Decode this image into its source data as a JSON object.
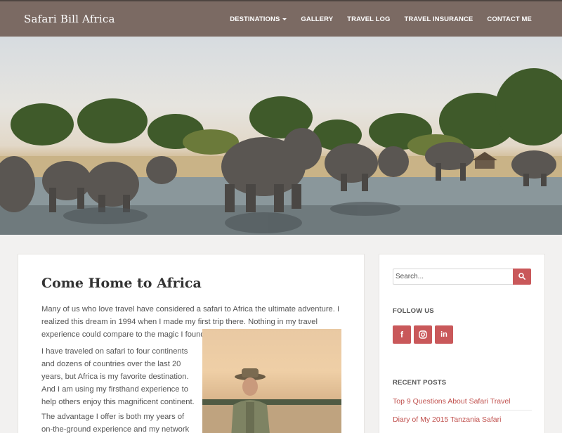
{
  "site": {
    "brand": "Safari Bill Africa"
  },
  "nav": {
    "items": [
      {
        "label": "Destinations"
      },
      {
        "label": "Gallery"
      },
      {
        "label": "Travel Log"
      },
      {
        "label": "Travel Insurance"
      },
      {
        "label": "Contact Me"
      }
    ]
  },
  "main": {
    "title": "Come Home to Africa",
    "paragraphs": [
      "Many of us who love travel have considered a safari to Africa the ultimate adventure. I realized this dream in 1994 when I made my first trip there. Nothing in my travel experience could compare to the magic I found in Africa.",
      "I have traveled on safari to four continents and dozens of countries over the last 20 years, but Africa is my favorite destination. And I am using my firsthand experience to help others enjoy this magnificent continent.",
      "The advantage I offer is both my years of on-the-ground experience and my network of contacts"
    ]
  },
  "sidebar": {
    "search": {
      "placeholder": "Search..."
    },
    "follow_title": "Follow Us",
    "social": [
      {
        "icon": "facebook-icon"
      },
      {
        "icon": "instagram-icon"
      },
      {
        "icon": "linkedin-icon"
      }
    ],
    "recent_title": "Recent Posts",
    "recent_posts": [
      "Top 9 Questions About Safari Travel",
      "Diary of My 2015 Tanzania Safari"
    ]
  },
  "colors": {
    "navbar": "#7b6a63",
    "accent": "#c9585a",
    "link": "#c0504d",
    "page_bg": "#f2f1f0"
  }
}
